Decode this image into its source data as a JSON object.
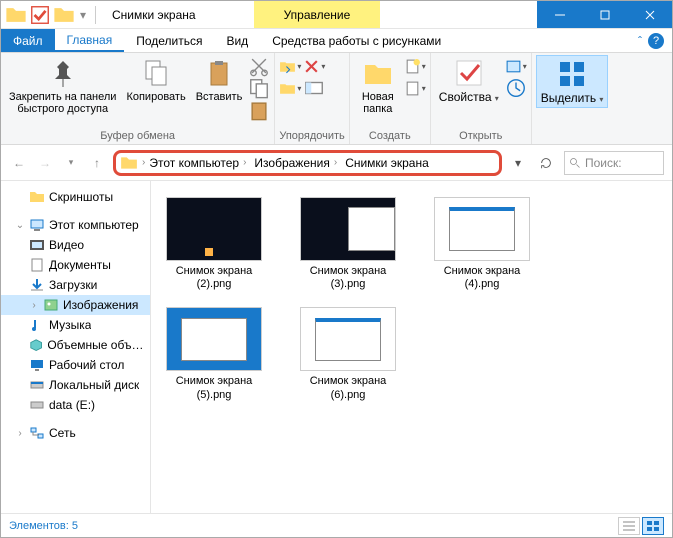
{
  "window": {
    "title": "Снимки экрана",
    "contextual_tab": "Управление"
  },
  "tabs": {
    "file": "Файл",
    "home": "Главная",
    "share": "Поделиться",
    "view": "Вид",
    "picture_tools": "Средства работы с рисунками"
  },
  "ribbon": {
    "pin": "Закрепить на панели\nбыстрого доступа",
    "copy": "Копировать",
    "paste": "Вставить",
    "clipboard_group": "Буфер обмена",
    "organize_group": "Упорядочить",
    "new_folder": "Новая\nпапка",
    "new_group": "Создать",
    "properties": "Свойства",
    "open_group": "Открыть",
    "select": "Выделить"
  },
  "breadcrumb": {
    "root": "Этот компьютер",
    "mid": "Изображения",
    "leaf": "Снимки экрана"
  },
  "search_placeholder": "Поиск: ",
  "sidebar": {
    "screenshots": "Скриншоты",
    "this_pc": "Этот компьютер",
    "video": "Видео",
    "documents": "Документы",
    "downloads": "Загрузки",
    "images": "Изображения",
    "music": "Музыка",
    "objects3d": "Объемные объекты",
    "desktop": "Рабочий стол",
    "local_disk": "Локальный диск",
    "data_e": "data (E:)",
    "network": "Сеть"
  },
  "files": {
    "f1": "Снимок экрана (2).png",
    "f2": "Снимок экрана (3).png",
    "f3": "Снимок экрана (4).png",
    "f4": "Снимок экрана (5).png",
    "f5": "Снимок экрана (6).png"
  },
  "status": "Элементов: 5"
}
